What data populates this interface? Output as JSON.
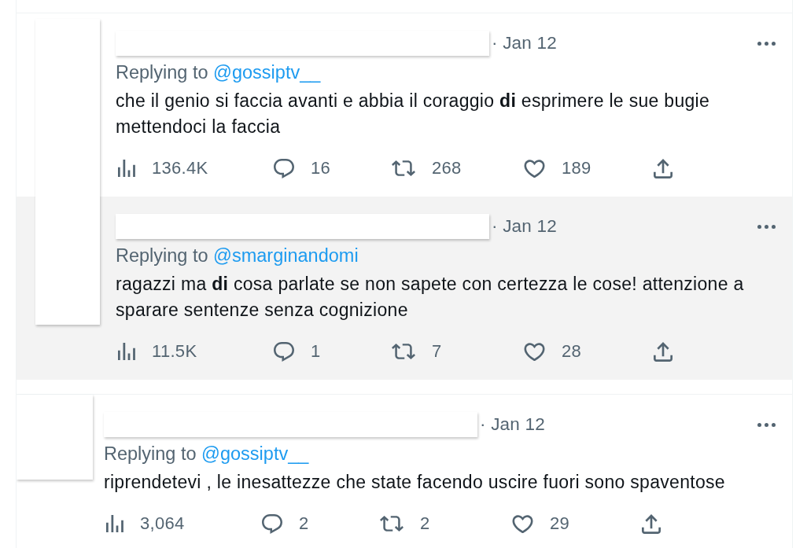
{
  "threads": [
    {
      "tweets": [
        {
          "date": "· Jan 12",
          "replying_label": "Replying to",
          "handle": "@gossiptv__",
          "text": "che il genio si faccia avanti e abbia il coraggio **di** esprimere le sue bugie mettendoci la faccia",
          "highlighted": false,
          "actions": [
            {
              "kind": "views",
              "count": "136.4K"
            },
            {
              "kind": "reply",
              "count": "16"
            },
            {
              "kind": "retweet",
              "count": "268"
            },
            {
              "kind": "like",
              "count": "189"
            },
            {
              "kind": "share"
            }
          ]
        },
        {
          "date": "· Jan 12",
          "replying_label": "Replying to",
          "handle": "@smarginandomi",
          "text": "ragazzi ma **di** cosa parlate se non sapete con certezza le cose! attenzione a sparare sentenze senza cognizione",
          "highlighted": true,
          "actions": [
            {
              "kind": "views",
              "count": "11.5K"
            },
            {
              "kind": "reply",
              "count": "1"
            },
            {
              "kind": "retweet",
              "count": "7"
            },
            {
              "kind": "like",
              "count": "28"
            },
            {
              "kind": "share"
            }
          ]
        }
      ]
    },
    {
      "tweets": [
        {
          "date": "· Jan 12",
          "replying_label": "Replying to",
          "handle": "@gossiptv__",
          "text": "riprendetevi , le inesattezze che state facendo uscire fuori sono spaventose",
          "highlighted": false,
          "actions": [
            {
              "kind": "views",
              "count": "3,064"
            },
            {
              "kind": "reply",
              "count": "2"
            },
            {
              "kind": "retweet",
              "count": "2"
            },
            {
              "kind": "like",
              "count": "29"
            },
            {
              "kind": "share"
            }
          ]
        }
      ]
    }
  ]
}
